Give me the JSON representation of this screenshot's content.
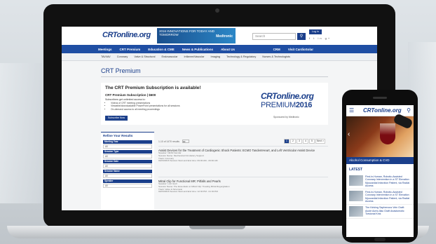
{
  "site": {
    "logo": "CRTonline.org",
    "banner_text": "2016 INNOVATIONS FOR TODAY AND TOMORROW",
    "banner_brand": "Medtronic",
    "search_placeholder": "Search",
    "login_label": "Log In",
    "social": "f  t  in  g+"
  },
  "nav": {
    "items": [
      "Meetings",
      "CRT Premium",
      "Education & CME",
      "News & Publications",
      "About Us"
    ],
    "right_items": [
      "CRM",
      "Visit CardioSolar"
    ]
  },
  "subnav": {
    "items": [
      "TAVI/AV",
      "Coronary",
      "Valve & Structural",
      "Endovascular",
      "Inflamm/Vascular",
      "Imaging",
      "Technology & Regulatory",
      "Nurses & Technologists"
    ]
  },
  "page": {
    "title": "CRT Premium"
  },
  "premium": {
    "heading": "The CRT Premium Subscription is available!",
    "price_line": "CRT Premium Subscription | $600",
    "lead": "Subscribers get unlimited access to:",
    "bullets": [
      "Videos of CRT meeting presentations",
      "Viewable/downloadable PowerPoint presentations for all sessions",
      "On-demand access to all meeting proceedings"
    ],
    "subscribe_label": "Subscribe Now",
    "logo_top": "CRTonline.org",
    "logo_premium": "PREMIUM",
    "logo_year": "2016",
    "sponsor": "Sponsored by Medtronic"
  },
  "refine": {
    "title": "Refine Your Results",
    "facets": [
      {
        "label": "Meeting Year",
        "value": "All"
      },
      {
        "label": "Session Type",
        "value": "All"
      },
      {
        "label": "Session Date",
        "value": "All"
      },
      {
        "label": "Session Name",
        "value": "All"
      },
      {
        "label": "Speaker",
        "value": "All"
      }
    ]
  },
  "results": {
    "count_text": "1-10 of 1470 results",
    "sort_value": "10",
    "pages": [
      "1",
      "2",
      "3",
      "4",
      "5"
    ],
    "next_label": "Next >",
    "items": [
      {
        "title": "Assist Devices for the Treatment of Cardiogenic Shock Patients: ECMO TandemHeart, and Left Ventricular Assist Device",
        "meta": [
          "Speaker: Nikhil Kamdar",
          "Session Name: Mechanical Circulatory Support",
          "Track: Coronary",
          "02/23/2016   Session Start and End time: 09:00 AM - 09:30 AM"
        ]
      },
      {
        "title": "Mitral Clip for Functional MR: Pitfalls and Pearls",
        "meta": [
          "Speaker: Lutz Grell",
          "Session Name: The Essentials on Mitral Clip: Treating Mitral Regurgitation",
          "Track: Valve & Structural",
          "02/23/2016   Session Start and End time: 12:30 PM - 01:30 PM"
        ]
      }
    ]
  },
  "phone": {
    "logo": "CRTonline.org",
    "hero_caption": "Alcohol Consumption & CVD",
    "latest_label": "LATEST",
    "items": [
      "First-in-Human, Robotic-Assisted Coronary Intervention in a ST Elevation Myocardial Infarction Patient, via Radial Access",
      "First-in-Human, Robotic-Assisted Coronary Intervention in a ST Elevation Myocardial Infarction Patient, via Radial Access",
      "The Kinking Saphenous Vein Graft: Acute Aorto-Iliac Graft Anastomotic Torsional Kink"
    ]
  }
}
